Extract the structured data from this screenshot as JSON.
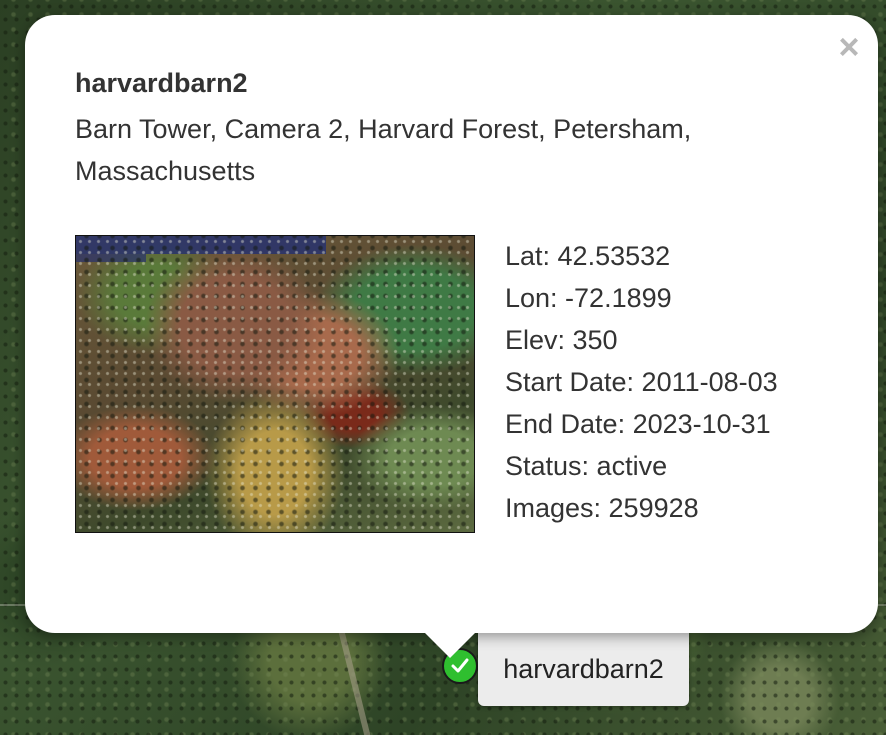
{
  "popup": {
    "camera_name": "harvardbarn2",
    "description": "Barn Tower, Camera 2, Harvard Forest, Petersham, Massachusetts",
    "close_label": "×",
    "details": {
      "lat": "Lat: 42.53532",
      "lon": "Lon: -72.1899",
      "elev": "Elev: 350",
      "start_date": "Start Date: 2011-08-03",
      "end_date": "End Date: 2023-10-31",
      "status": "Status: active",
      "images": "Images: 259928"
    }
  },
  "marker": {
    "label": "harvardbarn2",
    "icon": "checkmark-icon",
    "color": "#2fbf2f"
  }
}
